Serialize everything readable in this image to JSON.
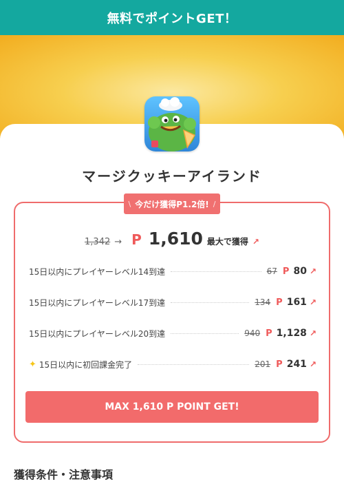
{
  "header": {
    "title": "無料でポイントGET！"
  },
  "app": {
    "name": "マージクッキーアイランド",
    "icon": "cookie-island-app-icon"
  },
  "promo": {
    "left": "\\",
    "text": "今だけ獲得P1.2倍!",
    "right": "/"
  },
  "total": {
    "old": "1,342",
    "arrow": "→",
    "currency": "P",
    "value": "1,610",
    "suffix": "最大で獲得",
    "up": "↗"
  },
  "rewards": [
    {
      "label": "15日以内にプレイヤーレベル14到達",
      "old": "67",
      "currency": "P",
      "value": "80",
      "up": "↗"
    },
    {
      "label": "15日以内にプレイヤーレベル17到達",
      "old": "134",
      "currency": "P",
      "value": "161",
      "up": "↗"
    },
    {
      "label": "15日以内にプレイヤーレベル20到達",
      "old": "940",
      "currency": "P",
      "value": "1,128",
      "up": "↗"
    },
    {
      "label": "15日以内に初回課金完了",
      "old": "201",
      "currency": "P",
      "value": "241",
      "up": "↗",
      "icon": "sparkle-icon"
    }
  ],
  "cta": {
    "label": "MAX 1,610 P POINT GET!"
  },
  "section": {
    "title": "獲得条件・注意事項"
  },
  "colors": {
    "header": "#14a89f",
    "accent": "#f26b6b",
    "hero": "#f2ad1f"
  }
}
